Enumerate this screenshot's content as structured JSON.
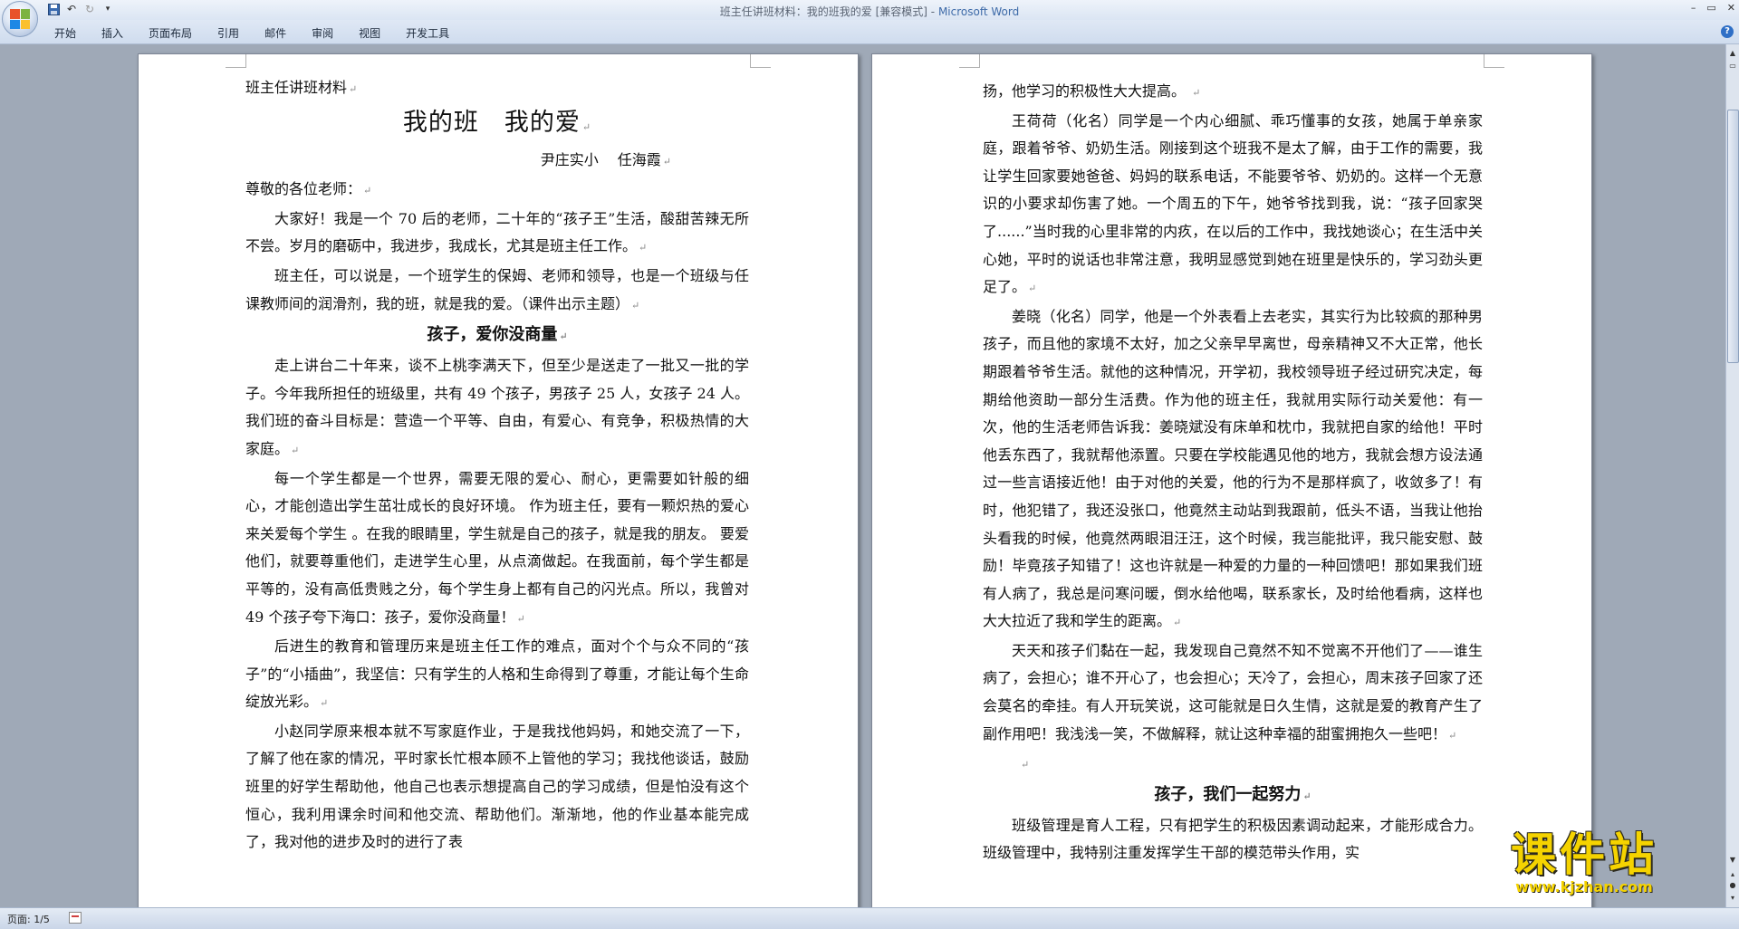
{
  "window": {
    "title_doc": "班主任讲班材料：我的班我的爱 [兼容模式]",
    "title_separator": " - ",
    "title_app": "Microsoft Word"
  },
  "quick_access": {
    "icons": [
      "save-icon",
      "undo-icon",
      "redo-icon",
      "customize-icon"
    ]
  },
  "ribbon": {
    "tabs": [
      "开始",
      "插入",
      "页面布局",
      "引用",
      "邮件",
      "审阅",
      "视图",
      "开发工具"
    ],
    "help_label": "?"
  },
  "left_page": {
    "header_line": "班主任讲班材料",
    "title": "我的班　我的爱",
    "author": "尹庄实小　 任海霞",
    "salutation": "尊敬的各位老师：",
    "p1": "大家好！我是一个 70 后的老师，二十年的“孩子王”生活，酸甜苦辣无所不尝。岁月的磨砺中，我进步，我成长，尤其是班主任工作。",
    "p2": "班主任，可以说是，一个班学生的保姆、老师和领导，也是一个班级与任课教师间的润滑剂，我的班，就是我的爱。（课件出示主题）",
    "section1": "孩子，爱你没商量",
    "p3": "走上讲台二十年来，谈不上桃李满天下，但至少是送走了一批又一批的学子。今年我所担任的班级里，共有 49 个孩子，男孩子 25 人，女孩子 24 人。我们班的奋斗目标是：营造一个平等、自由，有爱心、有竞争，积极热情的大家庭。",
    "p4": "每一个学生都是一个世界，需要无限的爱心、耐心，更需要如针般的细心，才能创造出学生茁壮成长的良好环境。 作为班主任，要有一颗炽热的爱心来关爱每个学生 。在我的眼睛里，学生就是自己的孩子，就是我的朋友。 要爱他们，就要尊重他们，走进学生心里，从点滴做起。在我面前，每个学生都是平等的，没有高低贵贱之分，每个学生身上都有自己的闪光点。所以，我曾对 49 个孩子夸下海口：孩子，爱你没商量！",
    "p5": "后进生的教育和管理历来是班主任工作的难点，面对个个与众不同的“孩子”的“小插曲”，我坚信：只有学生的人格和生命得到了尊重，才能让每个生命绽放光彩。",
    "p6": "小赵同学原来根本就不写家庭作业，于是我找他妈妈，和她交流了一下，了解了他在家的情况，平时家长忙根本顾不上管他的学习；我找他谈话，鼓励班里的好学生帮助他，他自己也表示想提高自己的学习成绩，但是怕没有这个恒心，我利用课余时间和他交流、帮助他们。渐渐地，他的作业基本能完成了，我对他的进步及时的进行了表"
  },
  "right_page": {
    "p0": "扬，他学习的积极性大大提高。 ",
    "p1": "王荷荷（化名）同学是一个内心细腻、乖巧懂事的女孩，她属于单亲家庭，跟着爷爷、奶奶生活。刚接到这个班我不是太了解，由于工作的需要，我让学生回家要她爸爸、妈妈的联系电话，不能要爷爷、奶奶的。这样一个无意识的小要求却伤害了她。一个周五的下午，她爷爷找到我，说：“孩子回家哭了......”当时我的心里非常的内疚，在以后的工作中，我找她谈心；在生活中关心她，平时的说话也非常注意，我明显感觉到她在班里是快乐的，学习劲头更足了。",
    "p2": "姜晓（化名）同学，他是一个外表看上去老实，其实行为比较疯的那种男孩子，而且他的家境不太好，加之父亲早早离世，母亲精神又不大正常，他长期跟着爷爷生活。就他的这种情况，开学初，我校领导班子经过研究决定，每期给他资助一部分生活费。作为他的班主任，我就用实际行动关爱他：有一次，他的生活老师告诉我：姜晓斌没有床单和枕巾，我就把自家的给他！平时他丢东西了，我就帮他添置。只要在学校能遇见他的地方，我就会想方设法通过一些言语接近他！由于对他的关爱，他的行为不是那样疯了，收敛多了！有时，他犯错了，我还没张口，他竟然主动站到我跟前，低头不语，当我让他抬头看我的时候，他竟然两眼泪汪汪，这个时候，我岂能批评，我只能安慰、鼓励！毕竟孩子知错了！这也许就是一种爱的力量的一种回馈吧！那如果我们班有人病了，我总是问寒问暖，倒水给他喝，联系家长，及时给他看病，这样也大大拉近了我和学生的距离。",
    "p3": "天天和孩子们黏在一起，我发现自己竟然不知不觉离不开他们了——谁生病了，会担心；谁不开心了，也会担心；天冷了，会担心，周末孩子回家了还会莫名的牵挂。有人开玩笑说，这可能就是日久生情，这就是爱的教育产生了副作用吧！我浅浅一笑，不做解释，就让这种幸福的甜蜜拥抱久一些吧！",
    "section2": "孩子，我们一起努力",
    "p4": "班级管理是育人工程，只有把学生的积极因素调动起来，才能形成合力。班级管理中，我特别注重发挥学生干部的模范带头作用，实"
  },
  "paragraph_mark": "↵",
  "status": {
    "page_indicator": "页面: 1/5"
  },
  "watermark": {
    "title": "课件站",
    "url": "www.kjzhan.com"
  },
  "colors": {
    "app_blue": "#3d6aa8",
    "workspace": "#9fa9b7",
    "watermark_yellow": "#f5d300"
  }
}
